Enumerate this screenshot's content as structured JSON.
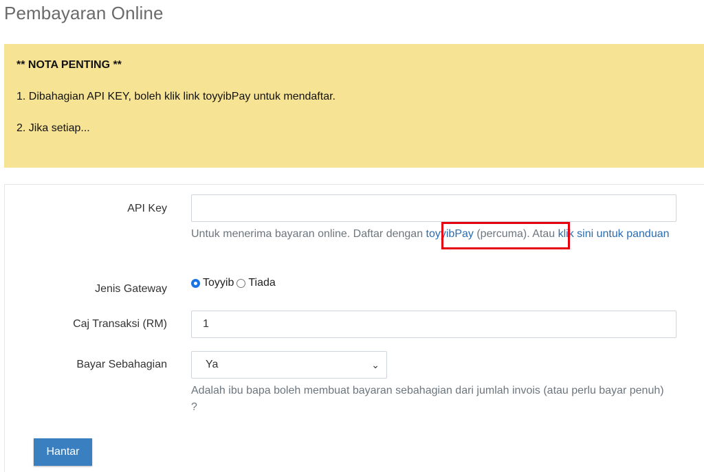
{
  "page": {
    "title": "Pembayaran Online"
  },
  "notice": {
    "title": "** NOTA PENTING **",
    "line1": "1. Dibahagian API KEY, boleh klik link toyyibPay untuk mendaftar.",
    "line2": "2. Jika setiap..."
  },
  "form": {
    "api_key": {
      "label": "API Key",
      "value": "",
      "help_prefix": "Untuk menerima bayaran online. Daftar dengan ",
      "help_link1": "toyyibPay",
      "help_middle": " (percuma). Atau ",
      "help_link2": "klik sini untuk panduan"
    },
    "gateway": {
      "label": "Jenis Gateway",
      "options": [
        "Toyyib",
        "Tiada"
      ],
      "selected": "Toyyib"
    },
    "fee": {
      "label": "Caj Transaksi (RM)",
      "value": "1"
    },
    "partial": {
      "label": "Bayar Sebahagian",
      "value": "Ya",
      "help": "Adalah ibu bapa boleh membuat bayaran sebahagian dari jumlah invois (atau perlu bayar penuh) ?"
    },
    "submit_label": "Hantar"
  },
  "colors": {
    "notice_bg": "#f7e394",
    "link": "#2a6cb0",
    "button": "#3a7fc0",
    "highlight": "#e4000f"
  },
  "icons": {
    "select_arrow": "chevron-down-icon"
  }
}
